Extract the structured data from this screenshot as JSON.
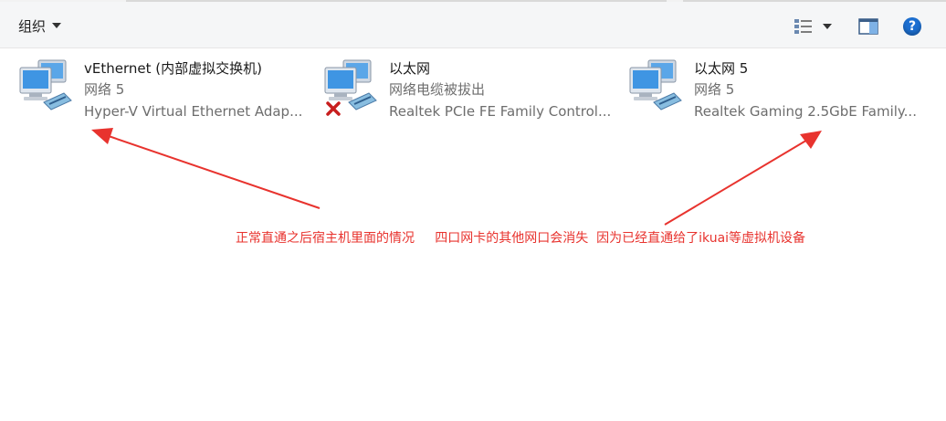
{
  "toolbar": {
    "organize_label": "组织",
    "view_icon": "view-options-icon",
    "pane_icon": "preview-pane-icon",
    "help_label": "?"
  },
  "adapters": [
    {
      "name": "vEthernet (内部虚拟交换机)",
      "status": "网络 5",
      "device": "Hyper-V Virtual Ethernet Adap...",
      "disconnected": false
    },
    {
      "name": "以太网",
      "status": "网络电缆被拔出",
      "device": "Realtek PCIe FE Family Control...",
      "disconnected": true
    },
    {
      "name": "以太网 5",
      "status": "网络 5",
      "device": "Realtek Gaming 2.5GbE Family...",
      "disconnected": false
    }
  ],
  "annotation": {
    "text": "正常直通之后宿主机里面的情况     四口网卡的其他网口会消失  因为已经直通给了ikuai等虚拟机设备",
    "color": "#e8332e"
  }
}
